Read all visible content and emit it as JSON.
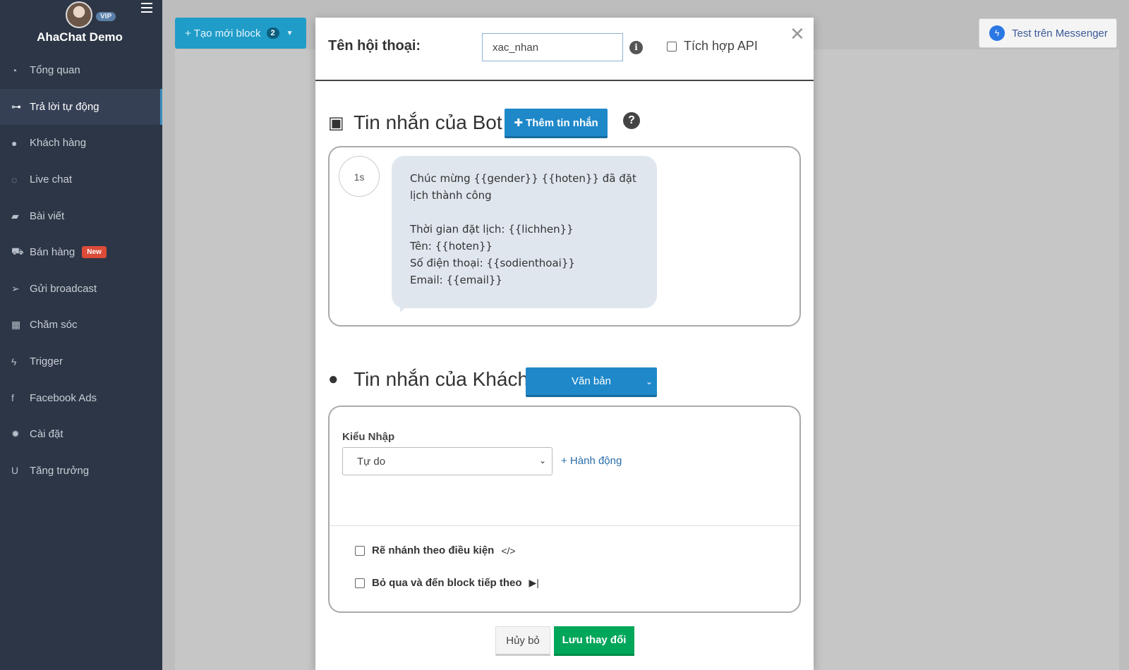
{
  "sidebar": {
    "brand": "AhaChat Demo",
    "vip": "VIP",
    "items": [
      {
        "label": "Tổng quan",
        "icon": "dashboard-icon",
        "glyph": "◔"
      },
      {
        "label": "Trả lời tự động",
        "icon": "sitemap-icon",
        "glyph": "⊶",
        "active": true
      },
      {
        "label": "Khách hàng",
        "icon": "user-icon",
        "glyph": "●"
      },
      {
        "label": "Live chat",
        "icon": "chat-bubble-icon",
        "glyph": "◌"
      },
      {
        "label": "Bài viết",
        "icon": "book-icon",
        "glyph": "▰"
      },
      {
        "label": "Bán hàng",
        "icon": "cart-icon",
        "glyph": "⛟",
        "badge": "New"
      },
      {
        "label": "Gửi broadcast",
        "icon": "paper-plane-icon",
        "glyph": "➢"
      },
      {
        "label": "Chăm sóc",
        "icon": "calendar-icon",
        "glyph": "▦"
      },
      {
        "label": "Trigger",
        "icon": "bolt-icon",
        "glyph": "ϟ"
      },
      {
        "label": "Facebook Ads",
        "icon": "facebook-icon",
        "glyph": "f"
      },
      {
        "label": "Cài đặt",
        "icon": "gear-icon",
        "glyph": "✹"
      },
      {
        "label": "Tăng trưởng",
        "icon": "magnet-icon",
        "glyph": "U"
      }
    ]
  },
  "toolbar": {
    "create_label": "+ Tạo mới block",
    "create_count": "2",
    "messenger_label": "Test trên Messenger"
  },
  "modal": {
    "conv_label": "Tên hội thoại:",
    "conv_value": "xac_nhan",
    "api_label": "Tích hợp API",
    "bot_title": "Tin nhắn của Bot",
    "add_msg_label": "✚ Thêm tin nhắn",
    "delay": "1s",
    "bot_message": "Chúc mừng {{gender}} {{hoten}} đã đặt\nlịch thành công\n\nThời gian đặt lịch: {{lichhen}}\nTên: {{hoten}}\nSố điện thoại: {{sodienthoai}}\nEmail: {{email}}",
    "customer_title": "Tin nhắn của Khách",
    "type_value": "Văn bản",
    "input_type_label": "Kiểu Nhập",
    "input_type_value": "Tự do",
    "action_link": "+ Hành động",
    "branch_label": "Rẽ nhánh theo điều kiện",
    "skip_label": "Bỏ qua và đến block tiếp theo",
    "cancel_label": "Hủy bỏ",
    "save_label": "Lưu thay đổi"
  },
  "colors": {
    "sidebar_bg": "#2d3646",
    "primary": "#1f88c9",
    "success": "#00a65a",
    "badge_red": "#dd4b39"
  }
}
